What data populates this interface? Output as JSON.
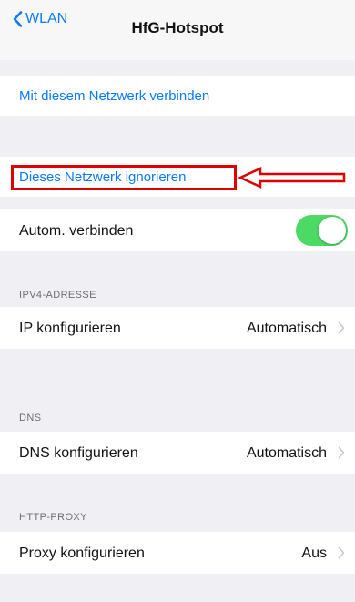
{
  "navbar": {
    "back_label": "WLAN",
    "title": "HfG-Hotspot"
  },
  "actions": {
    "join": "Mit diesem Netzwerk verbinden",
    "forget": "Dieses Netzwerk ignorieren"
  },
  "auto_join": {
    "label": "Autom. verbinden",
    "enabled": true
  },
  "ipv4": {
    "header": "IPV4-ADRESSE",
    "label": "IP konfigurieren",
    "value": "Automatisch"
  },
  "dns": {
    "header": "DNS",
    "label": "DNS konfigurieren",
    "value": "Automatisch"
  },
  "proxy": {
    "header": "HTTP-PROXY",
    "label": "Proxy konfigurieren",
    "value": "Aus"
  },
  "colors": {
    "link": "#0a7aff",
    "toggle_on": "#4cd964",
    "annotation": "#e00000",
    "background": "#efeff4"
  },
  "icons": {
    "back": "chevron-left-icon",
    "disclosure": "chevron-right-icon",
    "annotation": "arrow-left-icon"
  }
}
